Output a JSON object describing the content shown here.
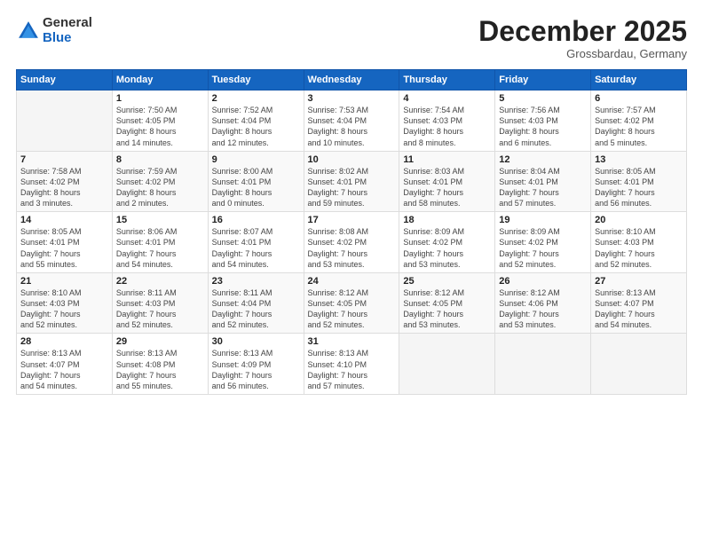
{
  "logo": {
    "general": "General",
    "blue": "Blue"
  },
  "header": {
    "title": "December 2025",
    "subtitle": "Grossbardau, Germany"
  },
  "weekdays": [
    "Sunday",
    "Monday",
    "Tuesday",
    "Wednesday",
    "Thursday",
    "Friday",
    "Saturday"
  ],
  "weeks": [
    [
      {
        "num": "",
        "info": ""
      },
      {
        "num": "1",
        "info": "Sunrise: 7:50 AM\nSunset: 4:05 PM\nDaylight: 8 hours\nand 14 minutes."
      },
      {
        "num": "2",
        "info": "Sunrise: 7:52 AM\nSunset: 4:04 PM\nDaylight: 8 hours\nand 12 minutes."
      },
      {
        "num": "3",
        "info": "Sunrise: 7:53 AM\nSunset: 4:04 PM\nDaylight: 8 hours\nand 10 minutes."
      },
      {
        "num": "4",
        "info": "Sunrise: 7:54 AM\nSunset: 4:03 PM\nDaylight: 8 hours\nand 8 minutes."
      },
      {
        "num": "5",
        "info": "Sunrise: 7:56 AM\nSunset: 4:03 PM\nDaylight: 8 hours\nand 6 minutes."
      },
      {
        "num": "6",
        "info": "Sunrise: 7:57 AM\nSunset: 4:02 PM\nDaylight: 8 hours\nand 5 minutes."
      }
    ],
    [
      {
        "num": "7",
        "info": "Sunrise: 7:58 AM\nSunset: 4:02 PM\nDaylight: 8 hours\nand 3 minutes."
      },
      {
        "num": "8",
        "info": "Sunrise: 7:59 AM\nSunset: 4:02 PM\nDaylight: 8 hours\nand 2 minutes."
      },
      {
        "num": "9",
        "info": "Sunrise: 8:00 AM\nSunset: 4:01 PM\nDaylight: 8 hours\nand 0 minutes."
      },
      {
        "num": "10",
        "info": "Sunrise: 8:02 AM\nSunset: 4:01 PM\nDaylight: 7 hours\nand 59 minutes."
      },
      {
        "num": "11",
        "info": "Sunrise: 8:03 AM\nSunset: 4:01 PM\nDaylight: 7 hours\nand 58 minutes."
      },
      {
        "num": "12",
        "info": "Sunrise: 8:04 AM\nSunset: 4:01 PM\nDaylight: 7 hours\nand 57 minutes."
      },
      {
        "num": "13",
        "info": "Sunrise: 8:05 AM\nSunset: 4:01 PM\nDaylight: 7 hours\nand 56 minutes."
      }
    ],
    [
      {
        "num": "14",
        "info": "Sunrise: 8:05 AM\nSunset: 4:01 PM\nDaylight: 7 hours\nand 55 minutes."
      },
      {
        "num": "15",
        "info": "Sunrise: 8:06 AM\nSunset: 4:01 PM\nDaylight: 7 hours\nand 54 minutes."
      },
      {
        "num": "16",
        "info": "Sunrise: 8:07 AM\nSunset: 4:01 PM\nDaylight: 7 hours\nand 54 minutes."
      },
      {
        "num": "17",
        "info": "Sunrise: 8:08 AM\nSunset: 4:02 PM\nDaylight: 7 hours\nand 53 minutes."
      },
      {
        "num": "18",
        "info": "Sunrise: 8:09 AM\nSunset: 4:02 PM\nDaylight: 7 hours\nand 53 minutes."
      },
      {
        "num": "19",
        "info": "Sunrise: 8:09 AM\nSunset: 4:02 PM\nDaylight: 7 hours\nand 52 minutes."
      },
      {
        "num": "20",
        "info": "Sunrise: 8:10 AM\nSunset: 4:03 PM\nDaylight: 7 hours\nand 52 minutes."
      }
    ],
    [
      {
        "num": "21",
        "info": "Sunrise: 8:10 AM\nSunset: 4:03 PM\nDaylight: 7 hours\nand 52 minutes."
      },
      {
        "num": "22",
        "info": "Sunrise: 8:11 AM\nSunset: 4:03 PM\nDaylight: 7 hours\nand 52 minutes."
      },
      {
        "num": "23",
        "info": "Sunrise: 8:11 AM\nSunset: 4:04 PM\nDaylight: 7 hours\nand 52 minutes."
      },
      {
        "num": "24",
        "info": "Sunrise: 8:12 AM\nSunset: 4:05 PM\nDaylight: 7 hours\nand 52 minutes."
      },
      {
        "num": "25",
        "info": "Sunrise: 8:12 AM\nSunset: 4:05 PM\nDaylight: 7 hours\nand 53 minutes."
      },
      {
        "num": "26",
        "info": "Sunrise: 8:12 AM\nSunset: 4:06 PM\nDaylight: 7 hours\nand 53 minutes."
      },
      {
        "num": "27",
        "info": "Sunrise: 8:13 AM\nSunset: 4:07 PM\nDaylight: 7 hours\nand 54 minutes."
      }
    ],
    [
      {
        "num": "28",
        "info": "Sunrise: 8:13 AM\nSunset: 4:07 PM\nDaylight: 7 hours\nand 54 minutes."
      },
      {
        "num": "29",
        "info": "Sunrise: 8:13 AM\nSunset: 4:08 PM\nDaylight: 7 hours\nand 55 minutes."
      },
      {
        "num": "30",
        "info": "Sunrise: 8:13 AM\nSunset: 4:09 PM\nDaylight: 7 hours\nand 56 minutes."
      },
      {
        "num": "31",
        "info": "Sunrise: 8:13 AM\nSunset: 4:10 PM\nDaylight: 7 hours\nand 57 minutes."
      },
      {
        "num": "",
        "info": ""
      },
      {
        "num": "",
        "info": ""
      },
      {
        "num": "",
        "info": ""
      }
    ]
  ]
}
